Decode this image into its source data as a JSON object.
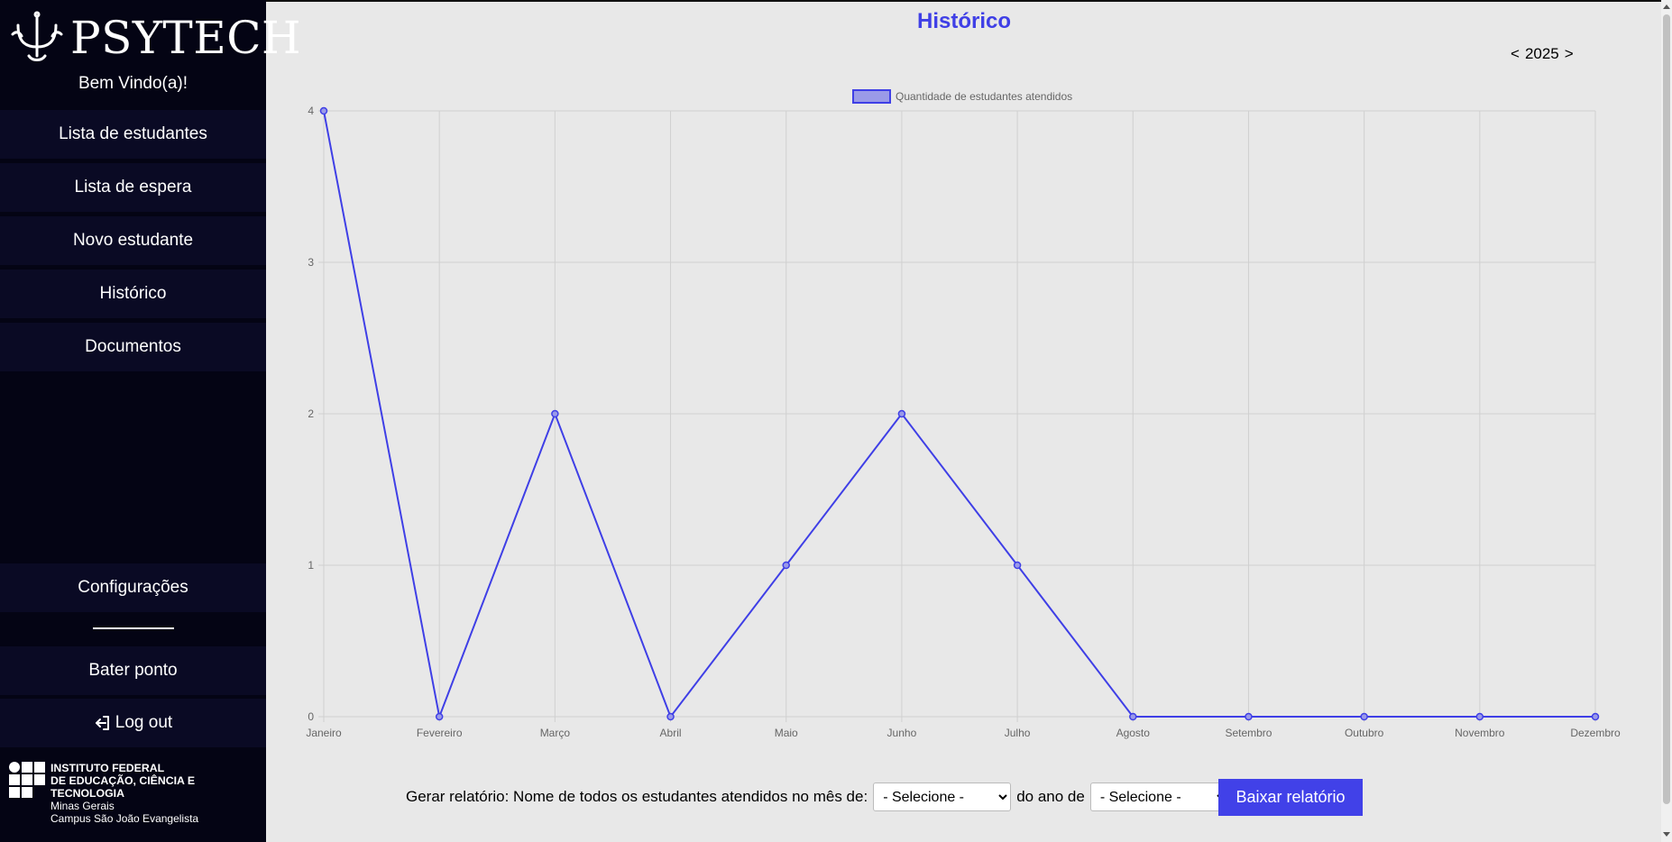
{
  "sidebar": {
    "brand": "PSYTECH",
    "welcome": "Bem Vindo(a)!",
    "items": [
      {
        "label": "Lista de estudantes"
      },
      {
        "label": "Lista de espera"
      },
      {
        "label": "Novo estudante"
      },
      {
        "label": "Histórico"
      },
      {
        "label": "Documentos"
      }
    ],
    "settings": "Configurações",
    "clock_in": "Bater ponto",
    "logout": "Log out",
    "institution": {
      "line1": "INSTITUTO FEDERAL",
      "line2": "DE EDUCAÇÃO, CIÊNCIA E TECNOLOGIA",
      "line3": "Minas Gerais",
      "line4": "Campus São João Evangelista"
    }
  },
  "main": {
    "title": "Histórico",
    "year_prev": "<",
    "year": "2025",
    "year_next": ">"
  },
  "chart_data": {
    "type": "line",
    "categories": [
      "Janeiro",
      "Fevereiro",
      "Março",
      "Abril",
      "Maio",
      "Junho",
      "Julho",
      "Agosto",
      "Setembro",
      "Outubro",
      "Novembro",
      "Dezembro"
    ],
    "series": [
      {
        "name": "Quantidade de estudantes atendidos",
        "values": [
          4,
          0,
          2,
          0,
          1,
          2,
          1,
          0,
          0,
          0,
          0,
          0
        ]
      }
    ],
    "ylim": [
      0,
      4
    ],
    "yticks": [
      0,
      1,
      2,
      3,
      4
    ],
    "grid": true,
    "legend": "top-center",
    "color": "#3f3fe6"
  },
  "report": {
    "label": "Gerar relatório: Nome de todos os estudantes atendidos no mês de:",
    "month_select": "- Selecione -",
    "year_label": "do ano de",
    "year_select": "- Selecione -",
    "button": "Baixar relatório"
  },
  "colors": {
    "accent": "#3f3fe6",
    "sidebar_bg": "#040414",
    "nav_item_bg": "#0a0a24",
    "page_bg": "#e8e8e8"
  }
}
